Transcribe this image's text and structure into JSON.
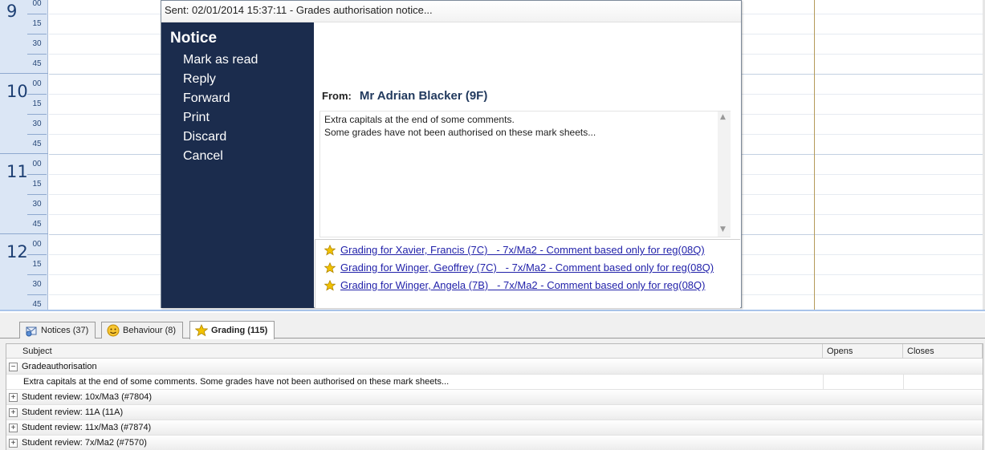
{
  "calendar": {
    "hours": [
      "9",
      "10",
      "11",
      "12"
    ],
    "minutes": [
      "00",
      "15",
      "30",
      "45"
    ]
  },
  "notice": {
    "title": "Sent: 02/01/2014 15:37:11 - Grades authorisation notice...",
    "menu_heading": "Notice",
    "menu_items": [
      "Mark as read",
      "Reply",
      "Forward",
      "Print",
      "Discard",
      "Cancel"
    ],
    "from_label": "From:",
    "from_value": "Mr Adrian Blacker (9F)",
    "message": "Extra capitals at the end of some comments.\nSome grades have not been authorised on these mark sheets...",
    "attachments": [
      "Grading for Xavier, Francis (7C)   - 7x/Ma2 - Comment based only for reg(08Q)",
      "Grading for Winger, Geoffrey (7C)   - 7x/Ma2 - Comment based only for reg(08Q)",
      "Grading for Winger, Angela (7B)   - 7x/Ma2 - Comment based only for reg(08Q)"
    ]
  },
  "tabs": [
    {
      "label": "Notices (37)",
      "icon": "notices-icon",
      "active": false
    },
    {
      "label": "Behaviour (8)",
      "icon": "smiley-icon",
      "active": false
    },
    {
      "label": "Grading (115)",
      "icon": "star-icon",
      "active": true
    }
  ],
  "table": {
    "columns": [
      "Subject",
      "Opens",
      "Closes"
    ],
    "rows": [
      {
        "type": "group",
        "expander": "−",
        "text": "Gradeauthorisation"
      },
      {
        "type": "detail",
        "text": "Extra capitals at the end of some comments. Some grades have not been authorised on these mark sheets..."
      },
      {
        "type": "group",
        "expander": "+",
        "text": "Student review: 10x/Ma3 (#7804)"
      },
      {
        "type": "group",
        "expander": "+",
        "text": "Student review: 11A (11A)"
      },
      {
        "type": "group",
        "expander": "+",
        "text": "Student review: 11x/Ma3 (#7874)"
      },
      {
        "type": "group",
        "expander": "+",
        "text": "Student review: 7x/Ma2 (#7570)"
      }
    ]
  },
  "colors": {
    "menu_bg": "#1b2c4d",
    "link": "#2222aa",
    "time_col_bg": "#dbe6f5",
    "hour_text": "#1d3f73",
    "star": "#f2c200"
  }
}
